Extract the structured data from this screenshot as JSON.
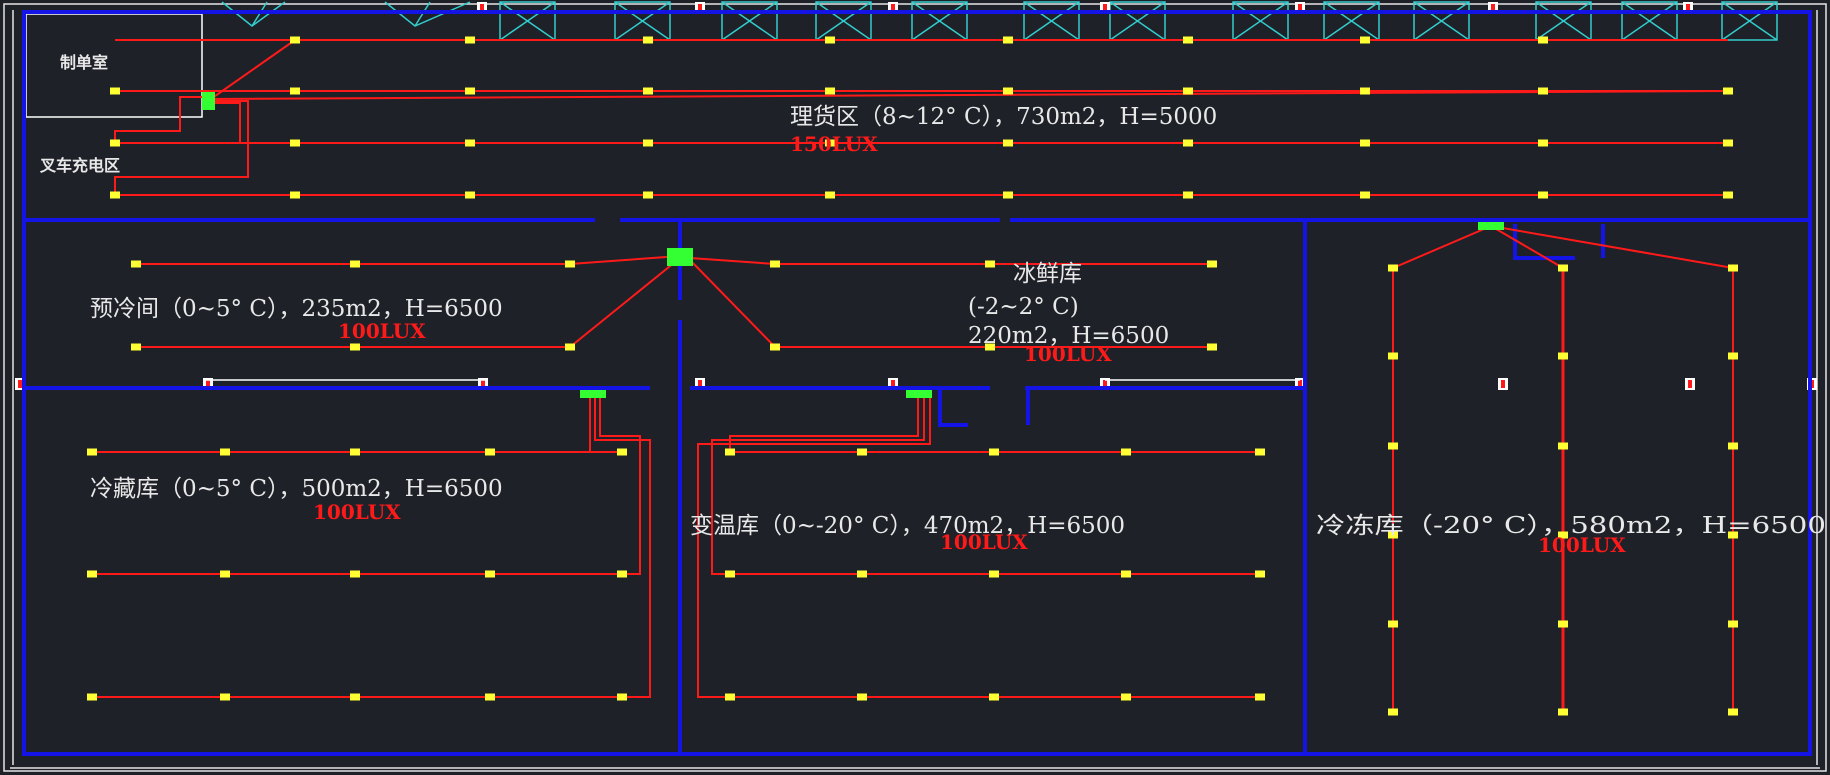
{
  "labels": {
    "control_room": "制单室",
    "forklift_charging": "叉车充电区",
    "sorting_area": "理货区（8~12° C），730m2，H=5000",
    "sorting_lux": "150LUX",
    "precool_room": "预冷间（0~5° C），235m2，H=6500",
    "precool_lux": "100LUX",
    "ice_fresh_title": "冰鲜库",
    "ice_fresh_temp": "(-2~2° C)",
    "ice_fresh_area": "220m2，H=6500",
    "ice_fresh_lux": "100LUX",
    "cold_storage": "冷藏库（0~5° C），500m2，H=6500",
    "cold_storage_lux": "100LUX",
    "variable_temp": "变温库（0~-20° C），470m2，H=6500",
    "variable_temp_lux": "100LUX",
    "freezer": "冷冻库（-20° C），580m2，H=6500",
    "freezer_lux": "100LUX"
  },
  "colors": {
    "background": "#1e2128",
    "wall": "#1414e6",
    "wiring": "#ff1a1a",
    "lamp": "#ffff33",
    "distribution_panel": "#33ff33",
    "window": "#33cccc",
    "text": "#e8e8e8"
  },
  "icons": [
    "lamp-fixture-icon",
    "distribution-panel-icon",
    "window-icon",
    "column-icon"
  ]
}
